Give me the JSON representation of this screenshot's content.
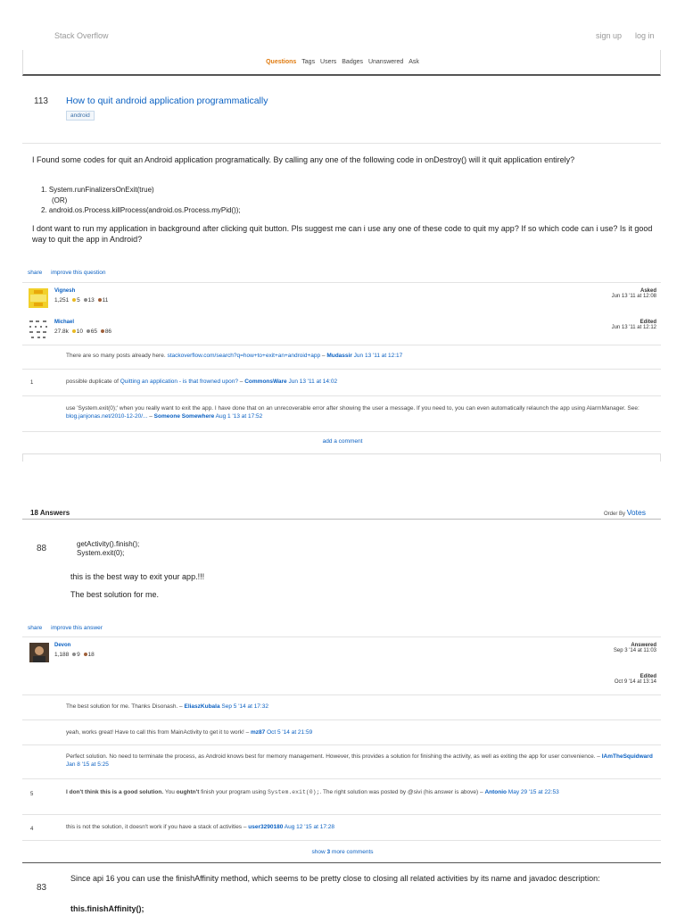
{
  "header": {
    "site_name": "Stack Overflow",
    "signup": "sign up",
    "login": "log in",
    "nav": [
      "Questions",
      "Tags",
      "Users",
      "Badges",
      "Unanswered",
      "Ask"
    ]
  },
  "question": {
    "votes": "113",
    "title": "How to quit android application programmatically",
    "tag": "android",
    "para1": "I Found some codes for quit an Android application programatically. By calling any one of the following code in onDestroy() will it quit application entirely?",
    "list_item1": "1. System.runFinalizersOnExit(true)",
    "list_or": "(OR)",
    "list_item2": "2. android.os.Process.killProcess(android.os.Process.myPid());",
    "para2": "I dont want to run my application in background after clicking quit button. Pls suggest me can i use any one of these code to quit my app? If so which code can i use? Is it good way to quit the app in Android?",
    "share": "share",
    "improve": "improve this question",
    "asker": {
      "name": "Vignesh",
      "rep": "1,251",
      "gold": "5",
      "silver": "13",
      "bronze": "11",
      "label": "Asked",
      "date": "Jun 13 '11 at 12:08"
    },
    "editor": {
      "name": "Michael",
      "rep": "27.8k",
      "gold": "10",
      "silver": "65",
      "bronze": "86",
      "label": "Edited",
      "date": "Jun 13 '11 at 12:12"
    },
    "comments": [
      {
        "score": "",
        "text": "There are so many posts already here. ",
        "link": "stackoverflow.com/search?q=how+to+exit+an+android+app",
        "sep": " – ",
        "user": "Mudassir",
        "date": " Jun 13 '11 at 12:17"
      },
      {
        "score": "1",
        "text": "possible duplicate of ",
        "link": "Quitting an application - is that frowned upon?",
        "sep": " – ",
        "user": "CommonsWare",
        "date": " Jun 13 '11 at 14:02"
      },
      {
        "score": "",
        "text": "use 'System.exit(0);' when you really want to exit the app. I have done that on an unrecoverable error after showing the user a message. If you need to, you can even automatically relaunch the app using AlarmManager. See: ",
        "link": "blog.janjonas.net/2010-12-20/...",
        "sep": " – ",
        "user": "Someone Somewhere",
        "date": " Aug 1 '13 at 17:52"
      }
    ],
    "add_comment": "add a comment"
  },
  "answers_header": {
    "count": "18 Answers",
    "order_label": "Order By",
    "order_value": "Votes"
  },
  "answer1": {
    "votes": "88",
    "code1": "getActivity().finish();",
    "code2": "System.exit(0);",
    "p1": "this is the best way to exit your app.!!!",
    "p2": "The best solution for me.",
    "share": "share",
    "improve": "improve this answer",
    "author": {
      "name": "Devon",
      "rep": "1,188",
      "gold": "",
      "silver": "9",
      "bronze": "18",
      "label": "Answered",
      "date": "Sep 3 '14 at 11:03"
    },
    "edited": {
      "label": "Edited",
      "date": "Oct 9 '14 at 13:14"
    },
    "comments": [
      {
        "score": "",
        "text": "The best solution for me. Thanks Disonash.",
        "sep": " – ",
        "user": "EliaszKubala",
        "date": " Sep 5 '14 at 17:32"
      },
      {
        "score": "",
        "text": "yeah, works great! Have to call this from MainActivity to get it to work!",
        "sep": " – ",
        "user": "mz87",
        "date": " Oct 5 '14 at 21:59"
      },
      {
        "score": "",
        "text": "Perfect solution. No need to terminate the process, as Android knows best for memory management. However, this provides a solution for finishing the activity, as well as exiting the app for user convenience.",
        "sep": " – ",
        "user": "IAmTheSquidward",
        "date": " Jan 8 '15 at 5:25"
      },
      {
        "score": "5",
        "bold1": "I don't think this is a good solution.",
        "text1": " You ",
        "bold2": "oughtn't",
        "text2": " finish your program using ",
        "code": "System.exit(0);",
        "text3": ". The right solution was posted by @sivi (his answer is above)",
        "sep": " – ",
        "user": "Antonio",
        "date": " May 29 '15 at 22:53"
      },
      {
        "score": "4",
        "text": "this is not the solution, it doesn't work if you have a stack of activities",
        "sep": " – ",
        "user": "user3290180",
        "date": " Aug 12 '15 at 17:28"
      }
    ],
    "show_more_prefix": "show ",
    "show_more_count": "3",
    "show_more_suffix": " more comments"
  },
  "answer2": {
    "votes": "83",
    "p1": "Since api 16 you can use the finishAffinity method, which seems to be pretty close to closing all related activities by its name and javadoc description:",
    "code": "this.finishAffinity();"
  }
}
